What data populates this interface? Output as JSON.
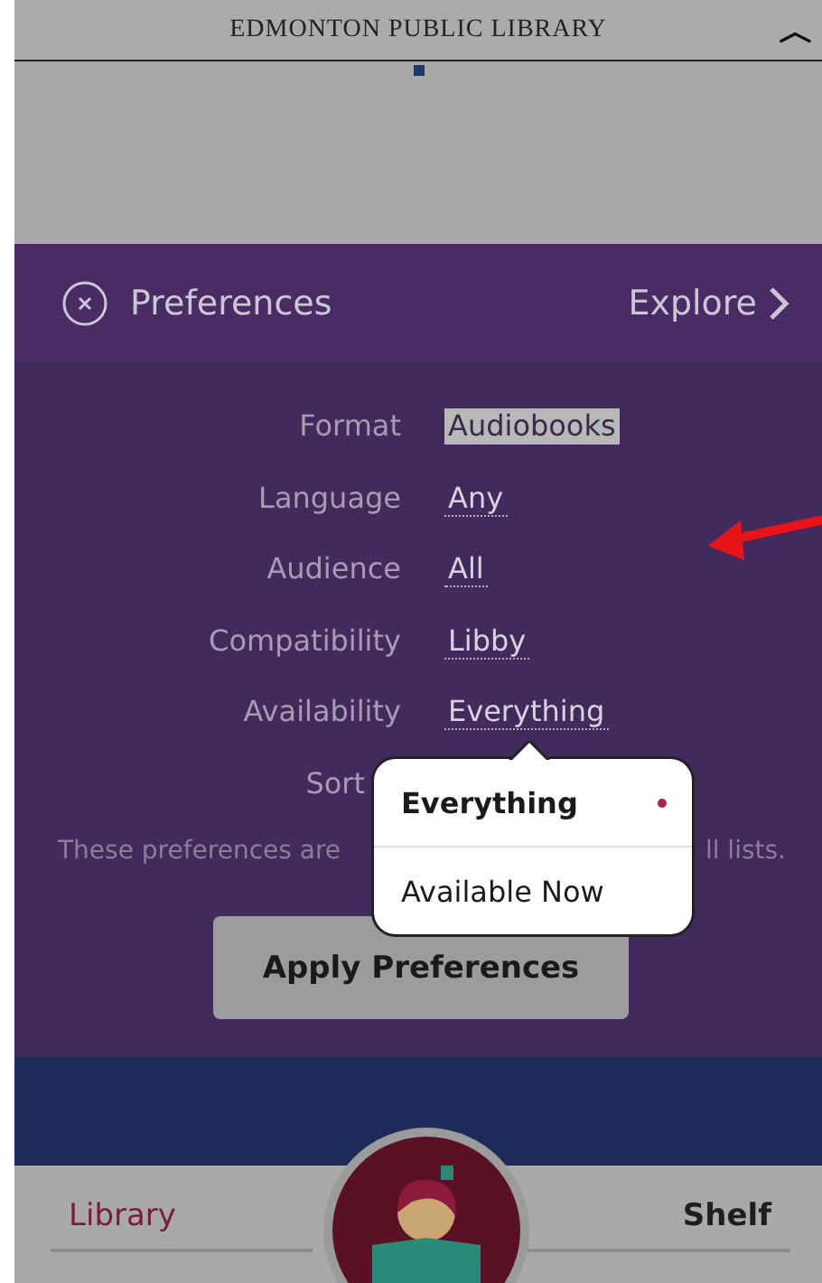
{
  "top_bar": {
    "title": "EDMONTON PUBLIC LIBRARY",
    "collapse_icon": "︿"
  },
  "preferences": {
    "title": "Preferences",
    "explore": "Explore",
    "rows": [
      {
        "label": "Format",
        "value": "Audiobooks",
        "highlighted": true
      },
      {
        "label": "Language",
        "value": "Any",
        "highlighted": false
      },
      {
        "label": "Audience",
        "value": "All",
        "highlighted": false
      },
      {
        "label": "Compatibility",
        "value": "Libby",
        "highlighted": false
      },
      {
        "label": "Availability",
        "value": "Everything",
        "highlighted": false
      },
      {
        "label": "Sort"
      }
    ],
    "note_parts": [
      "These preferences are",
      "ll lists."
    ],
    "apply_button": "Apply Preferences"
  },
  "availability_menu": {
    "options": [
      {
        "label": "Everything",
        "selected": true
      },
      {
        "label": "Available Now",
        "selected": false
      }
    ]
  },
  "bottom_nav": {
    "tabs": [
      {
        "label": "Library",
        "selected": true
      },
      {
        "label": "Shelf",
        "selected": false
      }
    ]
  }
}
